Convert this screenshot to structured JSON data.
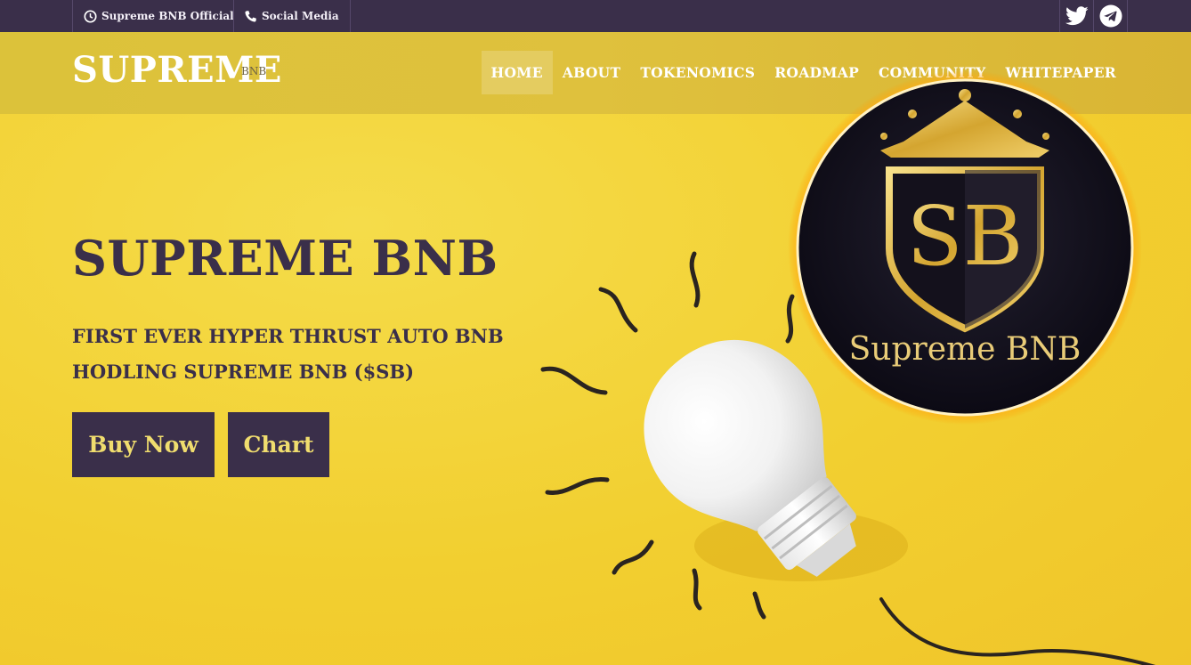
{
  "topbar": {
    "official": {
      "icon": "clock-icon",
      "label": "Supreme BNB Official"
    },
    "social": {
      "icon": "phone-icon",
      "label": "Social Media"
    },
    "icons": [
      "twitter-icon",
      "telegram-icon"
    ]
  },
  "header": {
    "logo": "SUPREME",
    "logo_sub": "BNB",
    "nav": [
      {
        "label": "HOME",
        "active": true
      },
      {
        "label": "ABOUT"
      },
      {
        "label": "TOKENOMICS"
      },
      {
        "label": "ROADMAP"
      },
      {
        "label": "COMMUNITY"
      },
      {
        "label": "WHITEPAPER"
      }
    ]
  },
  "hero": {
    "title": "SUPREME BNB",
    "subtitle": "FIRST EVER HYPER THRUST AUTO BNB HODLING SUPREME BNB ($SB)",
    "buy_label": "Buy Now",
    "chart_label": "Chart",
    "emblem": {
      "monogram": "SB",
      "text": "Supreme BNB"
    }
  },
  "colors": {
    "topbar": "#3a2f4a",
    "header": "#dcc23a",
    "hero_bg": "#f2cf30",
    "button_bg": "#3a2f4a",
    "button_text": "#f0dd6e",
    "emblem_gold": "#d9b23c"
  }
}
